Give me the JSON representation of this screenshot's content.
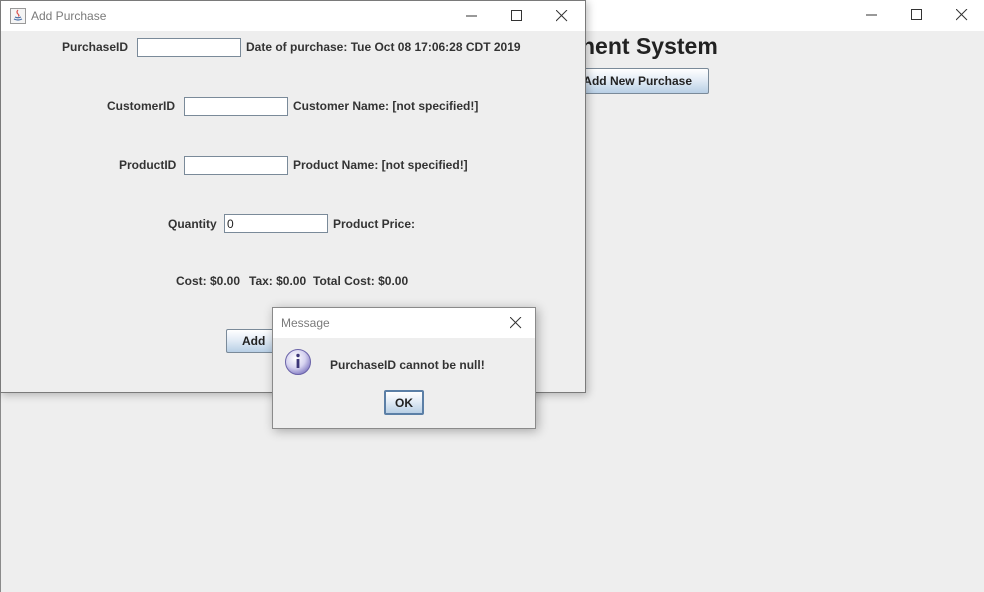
{
  "main_window": {
    "heading": "nent System",
    "add_new_purchase_button": "Add New Purchase"
  },
  "add_purchase": {
    "title": "Add Purchase",
    "purchase_id_label": "PurchaseID",
    "purchase_id_value": "",
    "date_label": "Date of purchase: Tue Oct 08 17:06:28 CDT 2019",
    "customer_id_label": "CustomerID",
    "customer_id_value": "",
    "customer_name_label": "Customer Name: [not specified!]",
    "product_id_label": "ProductID",
    "product_id_value": "",
    "product_name_label": "Product Name: [not specified!]",
    "quantity_label": "Quantity",
    "quantity_value": "0",
    "product_price_label": "Product Price:",
    "cost_label": "Cost: $0.00",
    "tax_label": "Tax: $0.00",
    "total_cost_label": "Total Cost: $0.00",
    "add_button": "Add"
  },
  "message_dialog": {
    "title": "Message",
    "message": "PurchaseID cannot be null!",
    "ok_button": "OK",
    "icon": "info-icon"
  },
  "colors": {
    "window_bg": "#eeeeee",
    "titlebar_bg": "#ffffff",
    "button_gradient_bottom": "#b8cfe5",
    "info_icon": "#8d86c9"
  }
}
